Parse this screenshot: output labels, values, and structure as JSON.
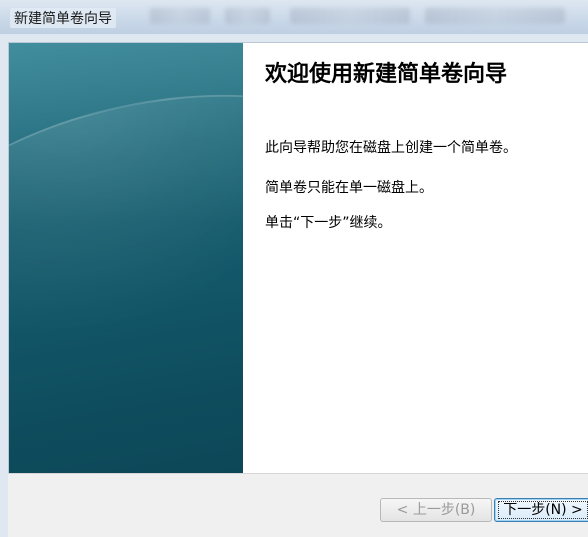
{
  "window": {
    "title": "新建简单卷向导"
  },
  "welcome": {
    "heading": "欢迎使用新建简单卷向导",
    "paragraphs": [
      "此向导帮助您在磁盘上创建一个简单卷。",
      "简单卷只能在单一磁盘上。",
      "单击“下一步”继续。"
    ]
  },
  "buttons": {
    "back_label": "< 上一步(B)",
    "next_label": "下一步(N) >"
  },
  "colors": {
    "side_panel": "#13586a",
    "titlebar": "#c9d8e8",
    "button_border_focus": "#3c7fb1"
  }
}
